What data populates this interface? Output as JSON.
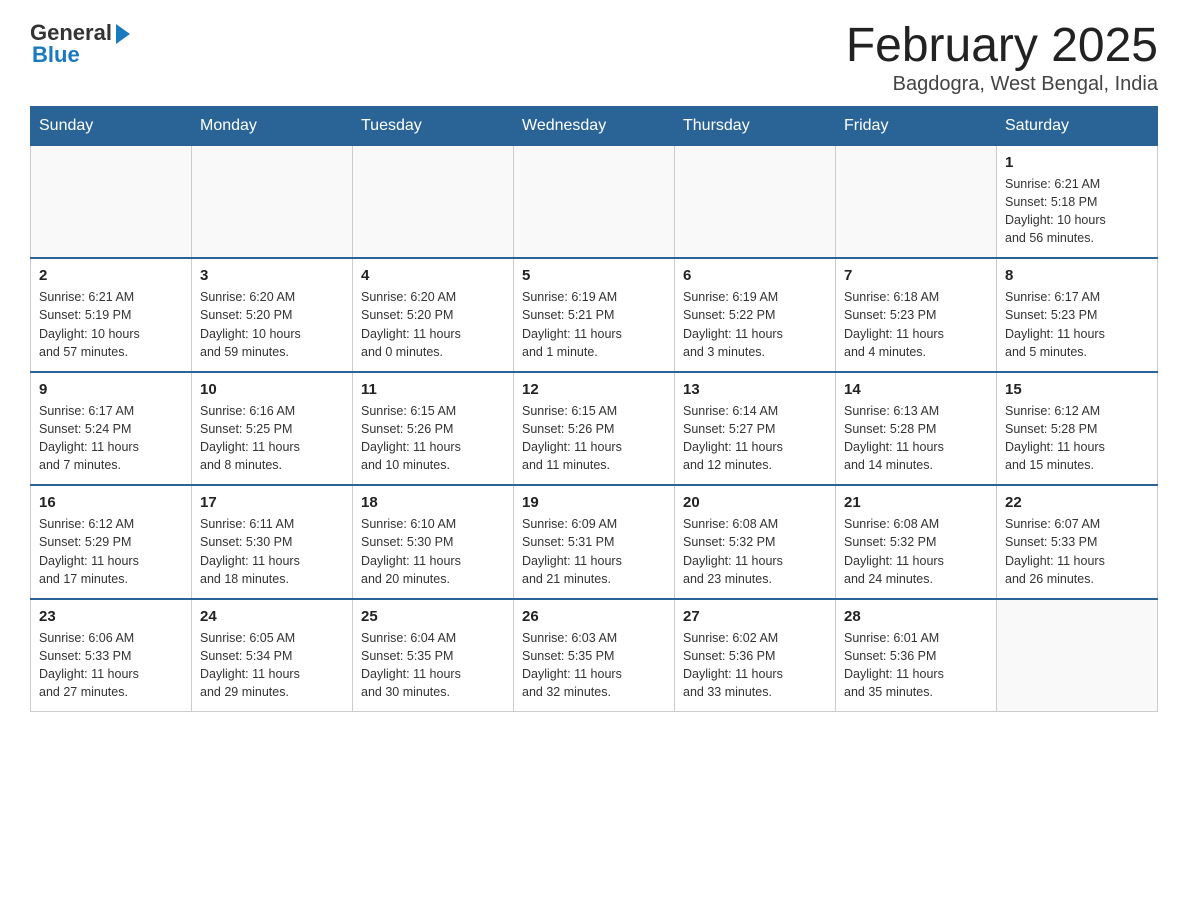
{
  "logo": {
    "general": "General",
    "blue": "Blue"
  },
  "title": "February 2025",
  "subtitle": "Bagdogra, West Bengal, India",
  "days_of_week": [
    "Sunday",
    "Monday",
    "Tuesday",
    "Wednesday",
    "Thursday",
    "Friday",
    "Saturday"
  ],
  "weeks": [
    [
      {
        "day": "",
        "info": ""
      },
      {
        "day": "",
        "info": ""
      },
      {
        "day": "",
        "info": ""
      },
      {
        "day": "",
        "info": ""
      },
      {
        "day": "",
        "info": ""
      },
      {
        "day": "",
        "info": ""
      },
      {
        "day": "1",
        "info": "Sunrise: 6:21 AM\nSunset: 5:18 PM\nDaylight: 10 hours\nand 56 minutes."
      }
    ],
    [
      {
        "day": "2",
        "info": "Sunrise: 6:21 AM\nSunset: 5:19 PM\nDaylight: 10 hours\nand 57 minutes."
      },
      {
        "day": "3",
        "info": "Sunrise: 6:20 AM\nSunset: 5:20 PM\nDaylight: 10 hours\nand 59 minutes."
      },
      {
        "day": "4",
        "info": "Sunrise: 6:20 AM\nSunset: 5:20 PM\nDaylight: 11 hours\nand 0 minutes."
      },
      {
        "day": "5",
        "info": "Sunrise: 6:19 AM\nSunset: 5:21 PM\nDaylight: 11 hours\nand 1 minute."
      },
      {
        "day": "6",
        "info": "Sunrise: 6:19 AM\nSunset: 5:22 PM\nDaylight: 11 hours\nand 3 minutes."
      },
      {
        "day": "7",
        "info": "Sunrise: 6:18 AM\nSunset: 5:23 PM\nDaylight: 11 hours\nand 4 minutes."
      },
      {
        "day": "8",
        "info": "Sunrise: 6:17 AM\nSunset: 5:23 PM\nDaylight: 11 hours\nand 5 minutes."
      }
    ],
    [
      {
        "day": "9",
        "info": "Sunrise: 6:17 AM\nSunset: 5:24 PM\nDaylight: 11 hours\nand 7 minutes."
      },
      {
        "day": "10",
        "info": "Sunrise: 6:16 AM\nSunset: 5:25 PM\nDaylight: 11 hours\nand 8 minutes."
      },
      {
        "day": "11",
        "info": "Sunrise: 6:15 AM\nSunset: 5:26 PM\nDaylight: 11 hours\nand 10 minutes."
      },
      {
        "day": "12",
        "info": "Sunrise: 6:15 AM\nSunset: 5:26 PM\nDaylight: 11 hours\nand 11 minutes."
      },
      {
        "day": "13",
        "info": "Sunrise: 6:14 AM\nSunset: 5:27 PM\nDaylight: 11 hours\nand 12 minutes."
      },
      {
        "day": "14",
        "info": "Sunrise: 6:13 AM\nSunset: 5:28 PM\nDaylight: 11 hours\nand 14 minutes."
      },
      {
        "day": "15",
        "info": "Sunrise: 6:12 AM\nSunset: 5:28 PM\nDaylight: 11 hours\nand 15 minutes."
      }
    ],
    [
      {
        "day": "16",
        "info": "Sunrise: 6:12 AM\nSunset: 5:29 PM\nDaylight: 11 hours\nand 17 minutes."
      },
      {
        "day": "17",
        "info": "Sunrise: 6:11 AM\nSunset: 5:30 PM\nDaylight: 11 hours\nand 18 minutes."
      },
      {
        "day": "18",
        "info": "Sunrise: 6:10 AM\nSunset: 5:30 PM\nDaylight: 11 hours\nand 20 minutes."
      },
      {
        "day": "19",
        "info": "Sunrise: 6:09 AM\nSunset: 5:31 PM\nDaylight: 11 hours\nand 21 minutes."
      },
      {
        "day": "20",
        "info": "Sunrise: 6:08 AM\nSunset: 5:32 PM\nDaylight: 11 hours\nand 23 minutes."
      },
      {
        "day": "21",
        "info": "Sunrise: 6:08 AM\nSunset: 5:32 PM\nDaylight: 11 hours\nand 24 minutes."
      },
      {
        "day": "22",
        "info": "Sunrise: 6:07 AM\nSunset: 5:33 PM\nDaylight: 11 hours\nand 26 minutes."
      }
    ],
    [
      {
        "day": "23",
        "info": "Sunrise: 6:06 AM\nSunset: 5:33 PM\nDaylight: 11 hours\nand 27 minutes."
      },
      {
        "day": "24",
        "info": "Sunrise: 6:05 AM\nSunset: 5:34 PM\nDaylight: 11 hours\nand 29 minutes."
      },
      {
        "day": "25",
        "info": "Sunrise: 6:04 AM\nSunset: 5:35 PM\nDaylight: 11 hours\nand 30 minutes."
      },
      {
        "day": "26",
        "info": "Sunrise: 6:03 AM\nSunset: 5:35 PM\nDaylight: 11 hours\nand 32 minutes."
      },
      {
        "day": "27",
        "info": "Sunrise: 6:02 AM\nSunset: 5:36 PM\nDaylight: 11 hours\nand 33 minutes."
      },
      {
        "day": "28",
        "info": "Sunrise: 6:01 AM\nSunset: 5:36 PM\nDaylight: 11 hours\nand 35 minutes."
      },
      {
        "day": "",
        "info": ""
      }
    ]
  ]
}
